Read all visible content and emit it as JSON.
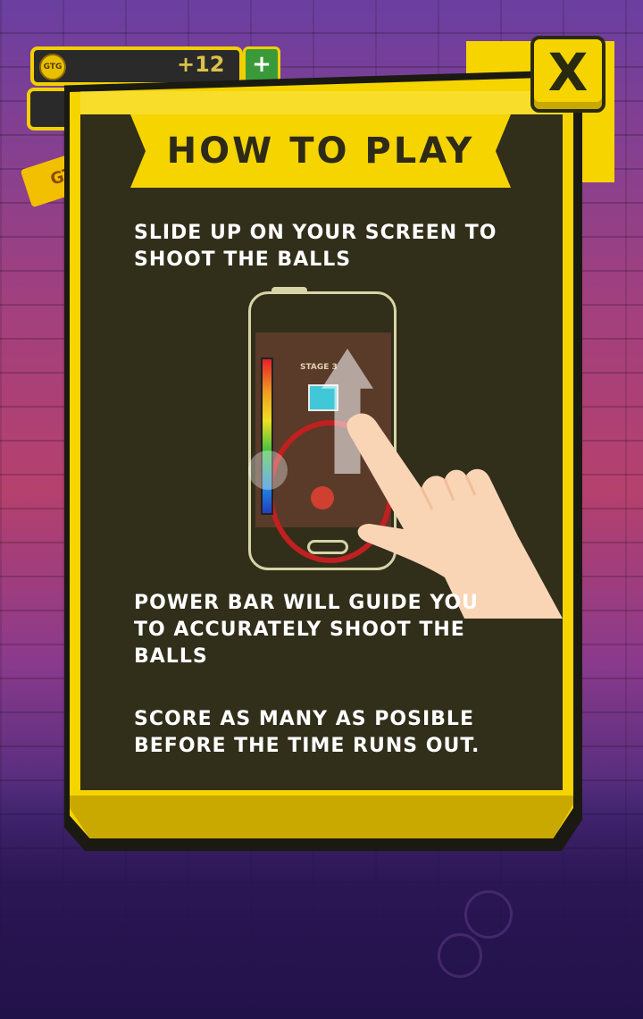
{
  "hud": {
    "coin_badge": "GTG",
    "coin_delta": "+12",
    "add_button": "+",
    "ticket_label": "GT"
  },
  "dialog": {
    "title": "HOW TO PLAY",
    "close_label": "X",
    "instructions": [
      "SLIDE UP ON YOUR SCREEN TO SHOOT THE BALLS",
      "POWER BAR WILL GUIDE YOU TO ACCURATELY SHOOT THE BALLS",
      "SCORE AS MANY AS POSIBLE BEFORE THE TIME RUNS OUT."
    ]
  },
  "tutorial_image": {
    "stage_label": "STAGE 3"
  },
  "colors": {
    "panel_yellow": "#f5d400",
    "panel_inner": "#312e1a",
    "title_text": "#2e2a18",
    "instruction_text": "#ffffff"
  },
  "icons": {
    "close": "close-x-icon",
    "add": "plus-icon",
    "coin": "coin-icon",
    "hand": "pointing-hand-icon",
    "arrow": "slide-up-arrow-icon"
  }
}
